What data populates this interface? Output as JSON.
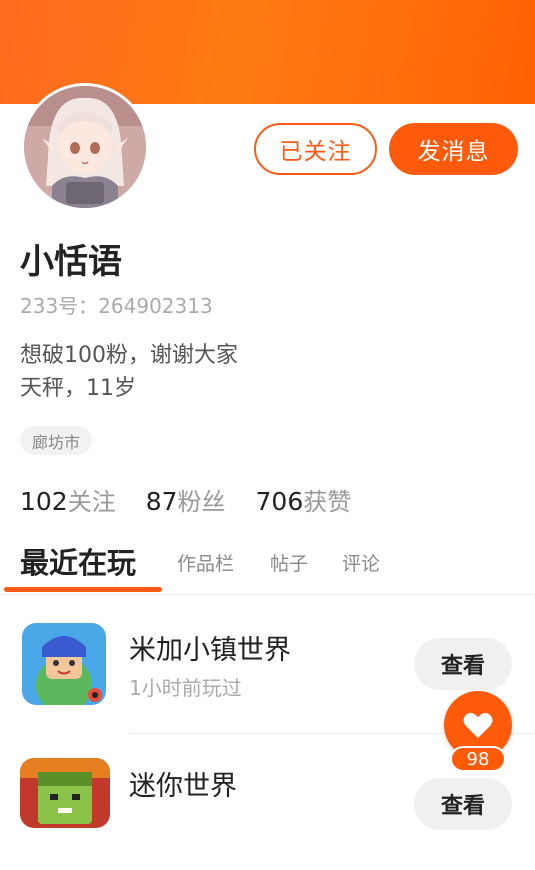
{
  "profile": {
    "name": "小恬语",
    "uid": "233号：264902313",
    "bio_line1": "想破100粉，谢谢大家",
    "bio_line2": "天秤，11岁",
    "location": "廊坊市"
  },
  "actions": {
    "follow_label": "已关注",
    "message_label": "发消息"
  },
  "stats": {
    "following_count": "102",
    "following_label": "关注",
    "fans_count": "87",
    "fans_label": "粉丝",
    "likes_count": "706",
    "likes_label": "获赞"
  },
  "tabs": [
    {
      "label": "最近在玩",
      "active": true
    },
    {
      "label": "作品栏",
      "active": false
    },
    {
      "label": "帖子",
      "active": false
    },
    {
      "label": "评论",
      "active": false
    }
  ],
  "games": [
    {
      "name": "米加小镇世界",
      "subtitle": "1小时前玩过",
      "button": "查看",
      "icon": "miga-town-icon"
    },
    {
      "name": "迷你世界",
      "subtitle": "",
      "button": "查看",
      "icon": "mini-world-icon"
    }
  ],
  "floating": {
    "like_count": "98",
    "icon": "heart-icon"
  },
  "colors": {
    "accent": "#ff5a0a",
    "banner": "#ff7b12",
    "muted_text": "#9a9a9a"
  }
}
